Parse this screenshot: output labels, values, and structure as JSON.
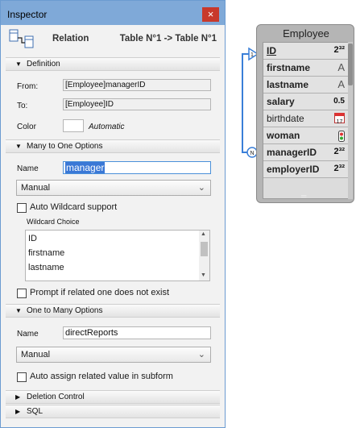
{
  "inspector": {
    "title": "Inspector",
    "close_label": "×",
    "header": {
      "label": "Relation",
      "tables": "Table N°1 -> Table N°1"
    },
    "definition": {
      "section_label": "Definition",
      "from_label": "From:",
      "from_value": "[Employee]managerID",
      "to_label": "To:",
      "to_value": "[Employee]ID",
      "color_label": "Color",
      "color_value": "Automatic"
    },
    "many_to_one": {
      "section_label": "Many to One Options",
      "name_label": "Name",
      "name_value": "manager",
      "mode_value": "Manual",
      "auto_wildcard_label": "Auto Wildcard support",
      "wildcard_choice_label": "Wildcard Choice",
      "wildcard_items": [
        "ID",
        "firstname",
        "lastname"
      ],
      "prompt_label": "Prompt if related one does not exist"
    },
    "one_to_many": {
      "section_label": "One to Many Options",
      "name_label": "Name",
      "name_value": "directReports",
      "mode_value": "Manual",
      "auto_assign_label": "Auto assign related value in subform"
    },
    "deletion_label": "Deletion Control",
    "sql_label": "SQL"
  },
  "employee_table": {
    "title": "Employee",
    "fields": [
      {
        "name": "ID",
        "type_icon": "integer-icon",
        "type_glyph": "2³²"
      },
      {
        "name": "firstname",
        "type_icon": "alpha-icon",
        "type_glyph": "A"
      },
      {
        "name": "lastname",
        "type_icon": "alpha-icon",
        "type_glyph": "A"
      },
      {
        "name": "salary",
        "type_icon": "real-icon",
        "type_glyph": "0.5"
      },
      {
        "name": "birthdate",
        "type_icon": "date-icon",
        "type_glyph": "17"
      },
      {
        "name": "woman",
        "type_icon": "boolean-icon",
        "type_glyph": ""
      },
      {
        "name": "managerID",
        "type_icon": "integer-icon",
        "type_glyph": "2³²"
      },
      {
        "name": "employerID",
        "type_icon": "integer-icon",
        "type_glyph": "2³²"
      }
    ],
    "relation_markers": {
      "one": "1",
      "many": "N"
    }
  }
}
